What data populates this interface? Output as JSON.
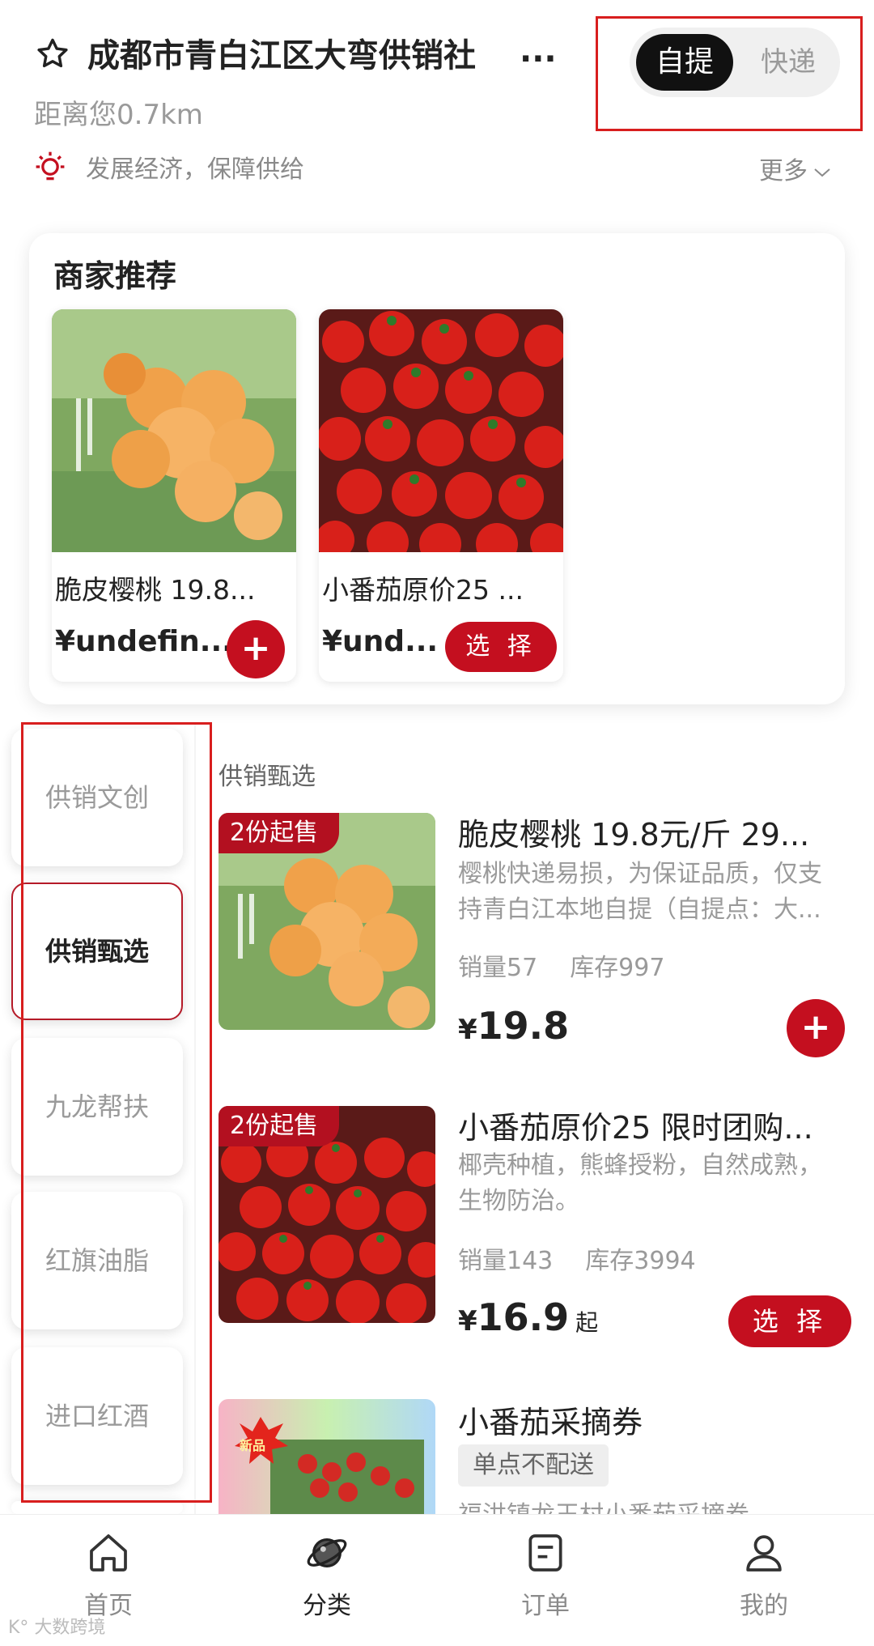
{
  "header": {
    "store_name": "成都市青白江区大弯供销社",
    "store_name_more": "...",
    "distance": "距离您0.7km",
    "slogan": "发展经济，保障供给",
    "more_label": "更多",
    "delivery_toggle": {
      "pickup_label": "自提",
      "express_label": "快递",
      "selected": "自提"
    }
  },
  "recommend": {
    "title": "商家推荐",
    "items": [
      {
        "name": "脆皮樱桃 19.8...",
        "price": "¥undefin...",
        "action": "+"
      },
      {
        "name": "小番茄原价25 ...",
        "price": "¥und...",
        "action": "选 择"
      }
    ]
  },
  "sidebar": {
    "items": [
      {
        "label": "供销文创"
      },
      {
        "label": "供销甄选"
      },
      {
        "label": "九龙帮扶"
      },
      {
        "label": "红旗油脂"
      },
      {
        "label": "进口红酒"
      }
    ],
    "active": "供销甄选"
  },
  "section": {
    "title": "供销甄选",
    "products": [
      {
        "badge": "2份起售",
        "name": "脆皮樱桃 19.8元/斤 29...",
        "desc": "樱桃快递易损，为保证品质，仅支持青白江本地自提（自提点：大...",
        "sales": "销量57",
        "stock": "库存997",
        "price_symbol": "¥",
        "price": "19.8",
        "action": "+"
      },
      {
        "badge": "2份起售",
        "name": "小番茄原价25 限时团购...",
        "desc": "椰壳种植，熊蜂授粉，自然成熟，生物防治。",
        "sales": "销量143",
        "stock": "库存3994",
        "price_symbol": "¥",
        "price": "16.9",
        "price_suffix": "起",
        "action": "选 择"
      },
      {
        "badge_new": "新品",
        "name": "小番茄采摘券",
        "tag": "单点不配送",
        "desc": "福洪镇龙王村小番茄采摘券"
      }
    ]
  },
  "bottom_nav": {
    "items": [
      {
        "label": "首页",
        "icon": "home-icon"
      },
      {
        "label": "分类",
        "icon": "planet-icon"
      },
      {
        "label": "订单",
        "icon": "order-icon"
      },
      {
        "label": "我的",
        "icon": "user-icon"
      }
    ],
    "active": "分类"
  },
  "watermark": "K° 大数跨境",
  "colors": {
    "brand_red": "#c40f1f",
    "annotation_red": "#d81e1e",
    "toggle_active": "#111111"
  }
}
